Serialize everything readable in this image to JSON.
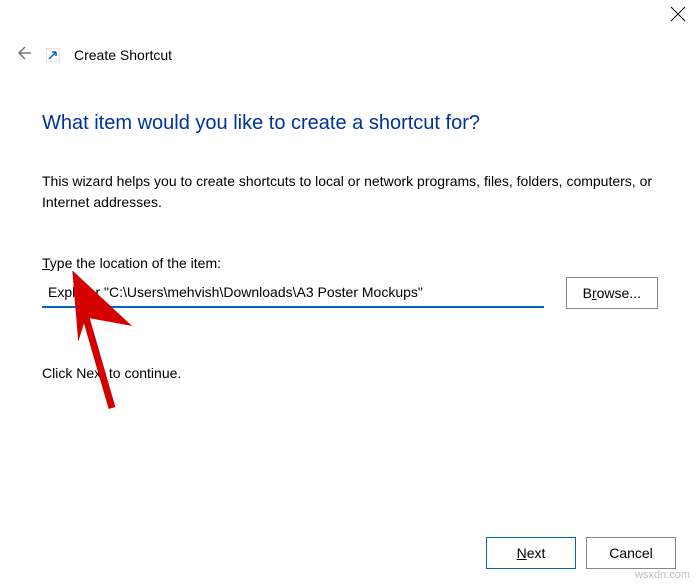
{
  "window": {
    "title": "Create Shortcut"
  },
  "wizard": {
    "heading": "What item would you like to create a shortcut for?",
    "description": "This wizard helps you to create shortcuts to local or network programs, files, folders, computers, or Internet addresses.",
    "field_label_prefix": "T",
    "field_label_rest": "ype the location of the item:",
    "location_value": "Explorer \"C:\\Users\\mehvish\\Downloads\\A3 Poster Mockups\"",
    "browse_prefix": "B",
    "browse_rest": "rowse...",
    "continue_text": "Click Next to continue."
  },
  "footer": {
    "next_prefix": "N",
    "next_rest": "ext",
    "cancel": "Cancel"
  },
  "watermark": "wsxdn.com"
}
